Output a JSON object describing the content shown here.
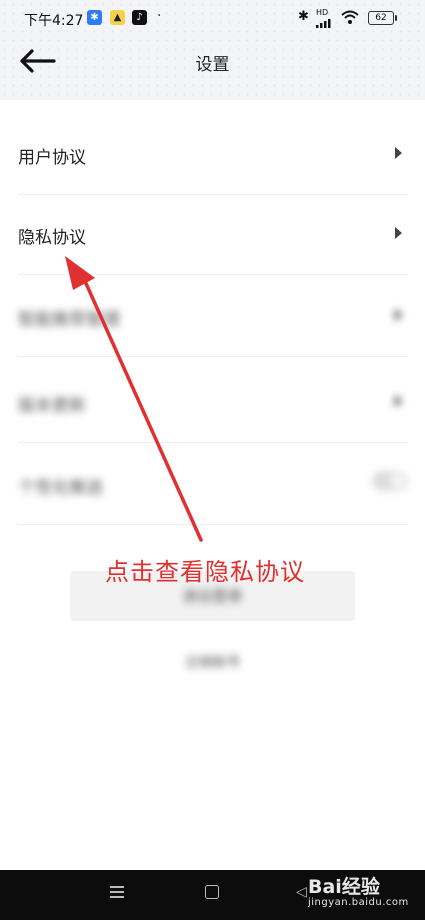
{
  "status_bar": {
    "time": "下午4:27",
    "battery": "62",
    "network": "HD"
  },
  "header": {
    "title": "设置"
  },
  "settings": {
    "items": [
      {
        "label": "用户协议"
      },
      {
        "label": "隐私协议"
      },
      {
        "label": "智能推荐管理"
      },
      {
        "label": "版本更新"
      },
      {
        "label": "个性化推送"
      }
    ],
    "logout_label": "退出登录",
    "cancel_account_label": "注销账号"
  },
  "annotation": {
    "text": "点击查看隐私协议",
    "color": "#e03030"
  },
  "watermark": {
    "main": "Bai经验",
    "sub": "jingyan.baidu.com"
  }
}
